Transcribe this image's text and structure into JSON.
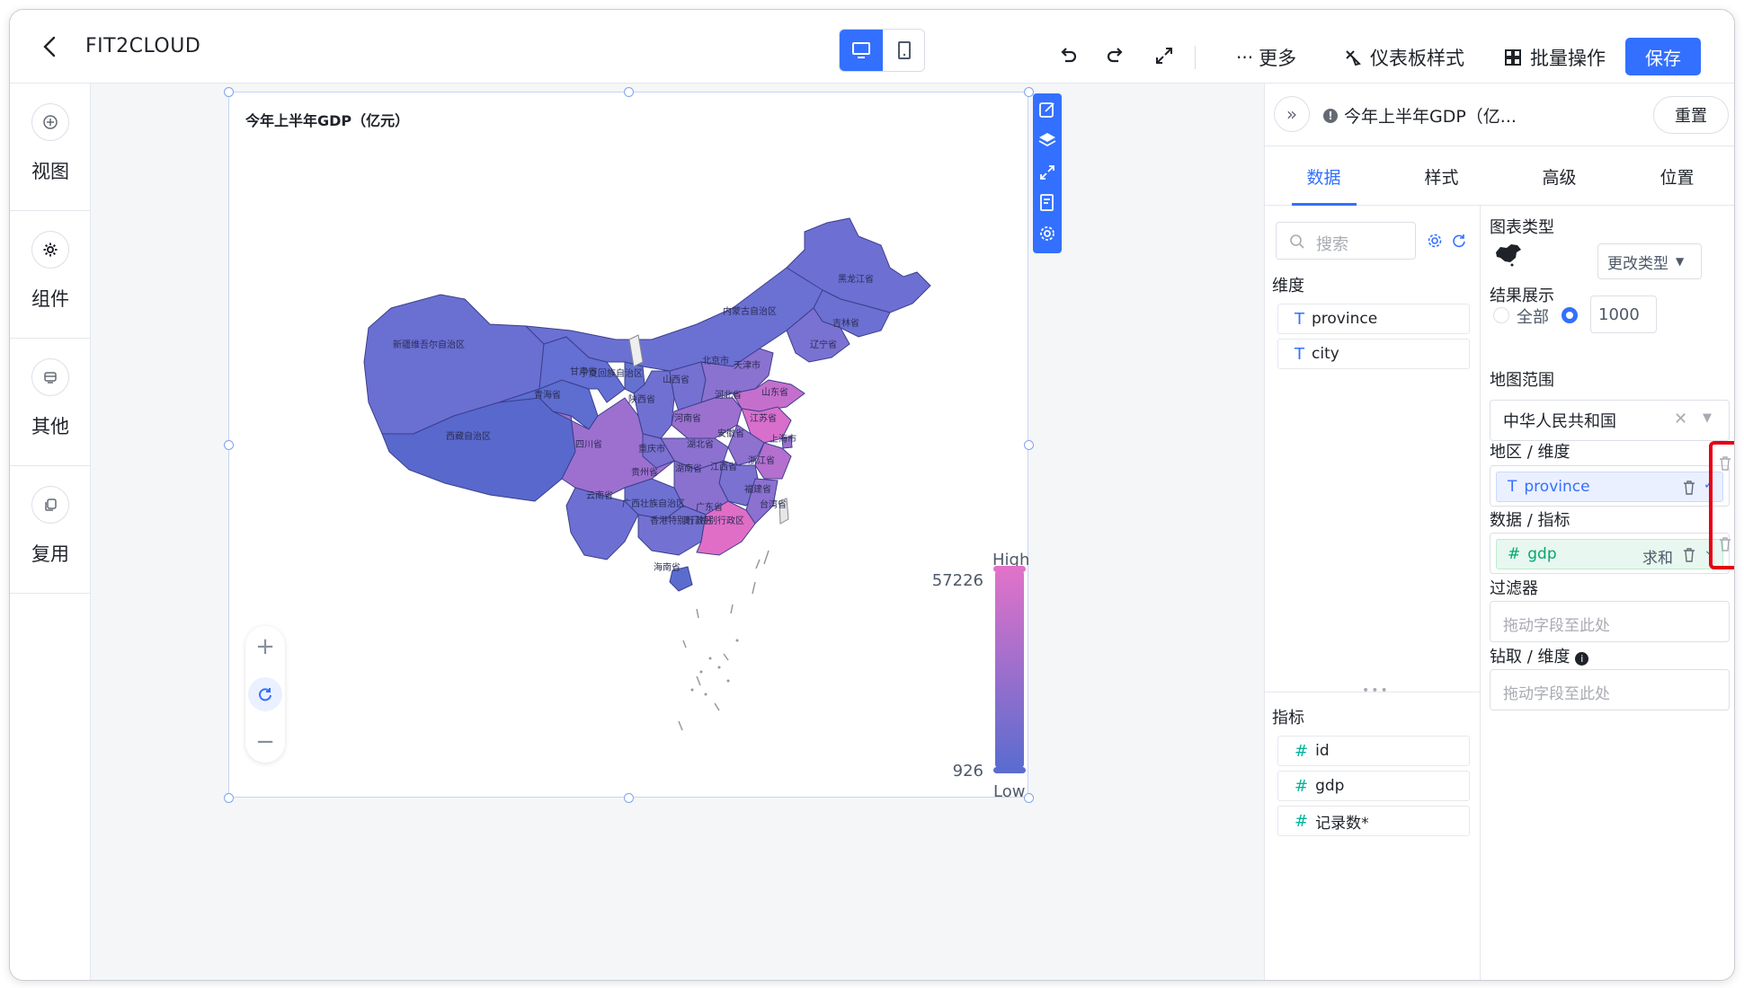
{
  "app": {
    "title": "FIT2CLOUD"
  },
  "header": {
    "more_label": "更多",
    "dashboard_style_label": "仪表板样式",
    "batch_label": "批量操作",
    "save_label": "保存"
  },
  "sidebar": {
    "items": [
      {
        "label": "视图",
        "icon": "plus-circle-icon"
      },
      {
        "label": "组件",
        "icon": "gear-icon"
      },
      {
        "label": "其他",
        "icon": "other-icon"
      },
      {
        "label": "复用",
        "icon": "copy-icon"
      }
    ]
  },
  "widget": {
    "title": "今年上半年GDP（亿元）",
    "legend": {
      "high": "High",
      "low": "Low",
      "max": "57226",
      "min": "926"
    },
    "colors": {
      "low": "#5b6ccf",
      "high": "#e072c9"
    },
    "region_labels": [
      "黑龙江省",
      "内蒙古自治区",
      "吉林省",
      "辽宁省",
      "新疆维吾尔自治区",
      "甘肃省",
      "青海省",
      "宁夏回族自治区",
      "山西省",
      "河北省",
      "北京市",
      "天津市",
      "山东省",
      "陕西省",
      "河南省",
      "江苏省",
      "安徽省",
      "上海市",
      "四川省",
      "重庆市",
      "湖北省",
      "浙江省",
      "西藏自治区",
      "贵州省",
      "湖南省",
      "江西省",
      "福建省",
      "云南省",
      "广西壮族自治区",
      "广东省",
      "台湾省",
      "香港特别行政区",
      "澳门特别行政区",
      "海南省"
    ]
  },
  "panel": {
    "title": "今年上半年GDP（亿...",
    "reset_label": "重置",
    "tabs": [
      "数据",
      "样式",
      "高级",
      "位置"
    ],
    "search_placeholder": "搜索",
    "dimension_label": "维度",
    "dimensions": [
      "province",
      "city"
    ],
    "measure_label": "指标",
    "measures": [
      "id",
      "gdp",
      "记录数*"
    ],
    "chart_type_label": "图表类型",
    "change_type_label": "更改类型",
    "result_label": "结果展示",
    "result_all": "全部",
    "result_limit": "1000",
    "map_range_label": "地图范围",
    "map_range_value": "中华人民共和国",
    "area_dim_label": "地区 / 维度",
    "area_dim_value": "province",
    "data_measure_label": "数据 / 指标",
    "data_measure_value": "gdp",
    "data_measure_agg": "求和",
    "filter_label": "过滤器",
    "filter_placeholder": "拖动字段至此处",
    "drill_label": "钻取 / 维度",
    "drill_placeholder": "拖动字段至此处"
  }
}
